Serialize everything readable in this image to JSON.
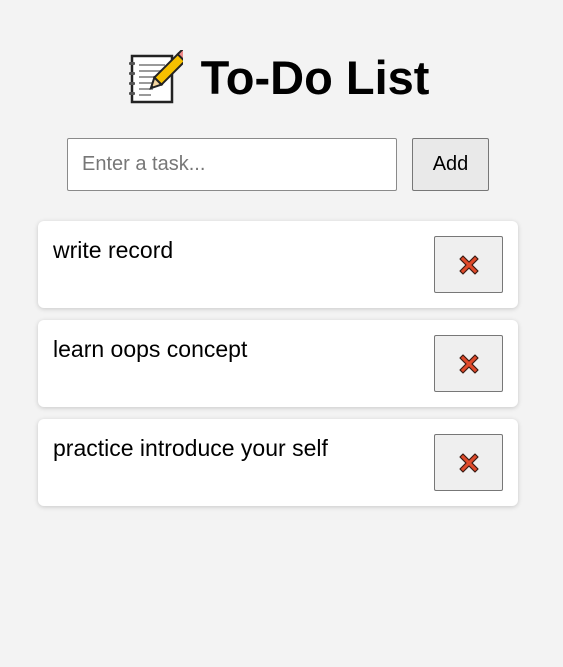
{
  "header": {
    "title": "To-Do List",
    "icon": "memo-icon"
  },
  "add_form": {
    "placeholder": "Enter a task...",
    "value": "",
    "add_label": "Add"
  },
  "tasks": [
    {
      "text": "write record",
      "delete_icon": "cross-mark-icon"
    },
    {
      "text": "learn oops concept",
      "delete_icon": "cross-mark-icon"
    },
    {
      "text": "practice introduce your self",
      "delete_icon": "cross-mark-icon"
    }
  ],
  "colors": {
    "background": "#f3f3f3",
    "card": "#ffffff",
    "delete_icon": "#e04a2b"
  }
}
